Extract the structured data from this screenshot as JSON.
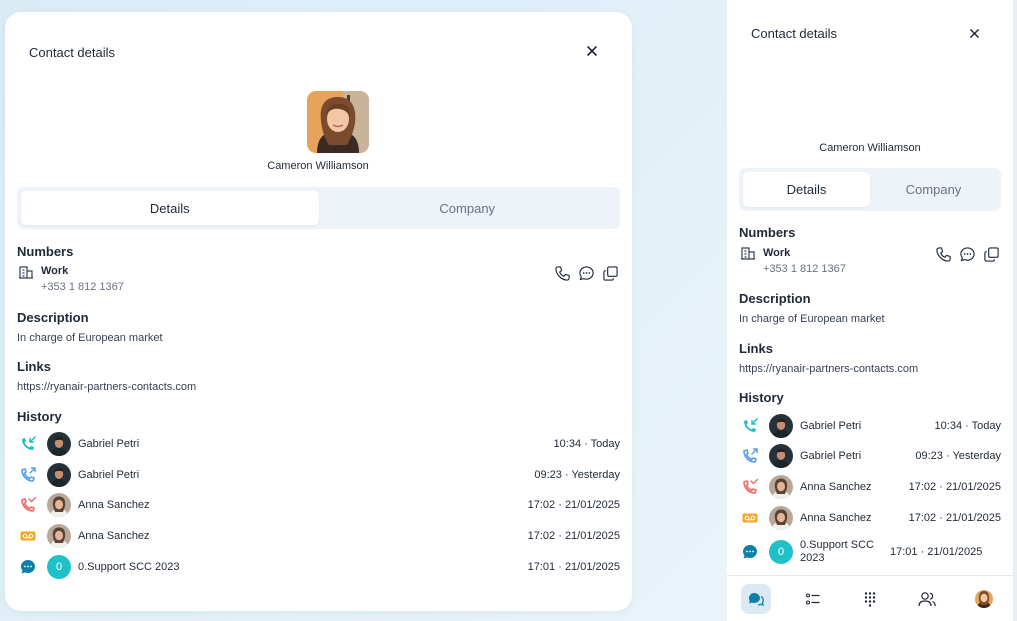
{
  "panel": {
    "title": "Contact details",
    "contact_name": "Cameron Williamson",
    "tabs": [
      {
        "label": "Details",
        "active": true
      },
      {
        "label": "Company",
        "active": false
      }
    ],
    "sections": {
      "numbers": "Numbers",
      "description": "Description",
      "links": "Links",
      "history": "History"
    },
    "number": {
      "label": "Work",
      "value": "+353 1 812 1367"
    },
    "description_text": "In charge of European market",
    "link_text": "https://ryanair-partners-contacts.com",
    "history": [
      {
        "type": "incoming-call",
        "name": "Gabriel Petri",
        "time": "10:34 · Today",
        "avatar": "man"
      },
      {
        "type": "outgoing-call",
        "name": "Gabriel Petri",
        "time": "09:23 · Yesterday",
        "avatar": "man"
      },
      {
        "type": "missed-call",
        "name": "Anna Sanchez",
        "time": "17:02 · 21/01/2025",
        "avatar": "woman"
      },
      {
        "type": "voicemail",
        "name": "Anna Sanchez",
        "time": "17:02 · 21/01/2025",
        "avatar": "woman"
      },
      {
        "type": "chat",
        "name": "0.Support SCC 2023",
        "time": "17:01 · 21/01/2025",
        "avatar": "0"
      }
    ]
  },
  "icons": {
    "close": "close-icon",
    "building": "building-icon",
    "phone": "phone-icon",
    "message": "message-icon",
    "copy": "copy-icon",
    "incoming": "incoming-call-icon",
    "outgoing": "outgoing-call-icon",
    "missed": "missed-call-icon",
    "voicemail": "voicemail-icon",
    "chat": "chat-icon",
    "nav": [
      "conversations-icon",
      "list-icon",
      "dialpad-icon",
      "contacts-icon",
      "profile-avatar"
    ]
  },
  "colors": {
    "incoming": "#1fc0c8",
    "outgoing": "#5b9ee8",
    "missed": "#f06a6a",
    "voicemail": "#f5a524",
    "chat": "#0e7fa6",
    "tab_bg": "#eef2f9",
    "nav_active": "#dbe9f5",
    "background": "#dcedf6"
  }
}
